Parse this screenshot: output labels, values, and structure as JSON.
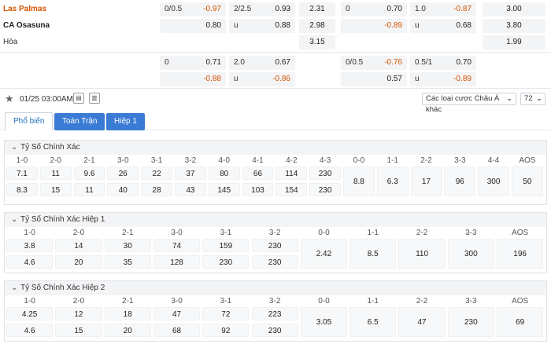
{
  "teams": {
    "home": "Las Palmas",
    "away": "CA Osasuna",
    "draw": "Hòa"
  },
  "odds_top": [
    {
      "lbl": "0/0.5",
      "val": "-0.97",
      "neg": true
    },
    {
      "lbl": "2/2.5",
      "val": "0.93",
      "neg": false
    },
    {
      "val": "2.31"
    },
    {
      "lbl": "0",
      "val": "0.70",
      "neg": false
    },
    {
      "lbl": "1.0",
      "val": "-0.87",
      "neg": true
    },
    {
      "val": "3.00"
    },
    {
      "lbl": "",
      "val": "0.80",
      "neg": false
    },
    {
      "lbl": "u",
      "val": "0.88",
      "neg": false
    },
    {
      "val": "2.98"
    },
    {
      "lbl": "",
      "val": "-0.89",
      "neg": true
    },
    {
      "lbl": "u",
      "val": "0.68",
      "neg": false
    },
    {
      "val": "3.80"
    },
    {
      "val": "3.15"
    },
    {
      "val": "1.99"
    }
  ],
  "odds_second": [
    {
      "lbl": "0",
      "val": "0.71",
      "neg": false
    },
    {
      "lbl": "2.0",
      "val": "0.67",
      "neg": false
    },
    {
      "lbl": "0/0.5",
      "val": "-0.76",
      "neg": true
    },
    {
      "lbl": "0.5/1",
      "val": "0.70",
      "neg": false
    },
    {
      "lbl": "",
      "val": "-0.88",
      "neg": true
    },
    {
      "lbl": "u",
      "val": "-0.86",
      "neg": true
    },
    {
      "lbl": "",
      "val": "0.57",
      "neg": false
    },
    {
      "lbl": "u",
      "val": "-0.89",
      "neg": true
    }
  ],
  "toolbar": {
    "datetime": "01/25 03:00AM",
    "bet_type": "Các loại cược Châu Á khác",
    "count": "72"
  },
  "tabs": [
    "Phổ biến",
    "Toàn Trận",
    "Hiệp 1"
  ],
  "correct_score": {
    "title": "Tỷ Số Chính Xác",
    "headers": [
      "1-0",
      "2-0",
      "2-1",
      "3-0",
      "3-1",
      "3-2",
      "4-0",
      "4-1",
      "4-2",
      "4-3",
      "0-0",
      "1-1",
      "2-2",
      "3-3",
      "4-4",
      "AOS"
    ],
    "row1": [
      "7.1",
      "11",
      "9.6",
      "26",
      "22",
      "37",
      "80",
      "66",
      "114",
      "230"
    ],
    "row2": [
      "8.3",
      "15",
      "11",
      "40",
      "28",
      "43",
      "145",
      "103",
      "154",
      "230"
    ],
    "mid": [
      "8.8",
      "6.3",
      "17",
      "96",
      "300",
      "50"
    ]
  },
  "correct_score_h1": {
    "title": "Tỷ Số Chính Xác Hiệp 1",
    "headers": [
      "1-0",
      "2-0",
      "2-1",
      "3-0",
      "3-1",
      "3-2",
      "0-0",
      "1-1",
      "2-2",
      "3-3",
      "AOS"
    ],
    "row1": [
      "3.8",
      "14",
      "30",
      "74",
      "159",
      "230"
    ],
    "row2": [
      "4.6",
      "20",
      "35",
      "128",
      "230",
      "230"
    ],
    "mid": [
      "2.42",
      "8.5",
      "110",
      "300",
      "196"
    ]
  },
  "correct_score_h2": {
    "title": "Tỷ Số Chính Xác Hiệp 2",
    "headers": [
      "1-0",
      "2-0",
      "2-1",
      "3-0",
      "3-1",
      "3-2",
      "0-0",
      "1-1",
      "2-2",
      "3-3",
      "AOS"
    ],
    "row1": [
      "4.25",
      "12",
      "18",
      "47",
      "72",
      "223"
    ],
    "row2": [
      "4.6",
      "15",
      "20",
      "68",
      "92",
      "230"
    ],
    "mid": [
      "3.05",
      "6.5",
      "47",
      "230",
      "69"
    ]
  }
}
